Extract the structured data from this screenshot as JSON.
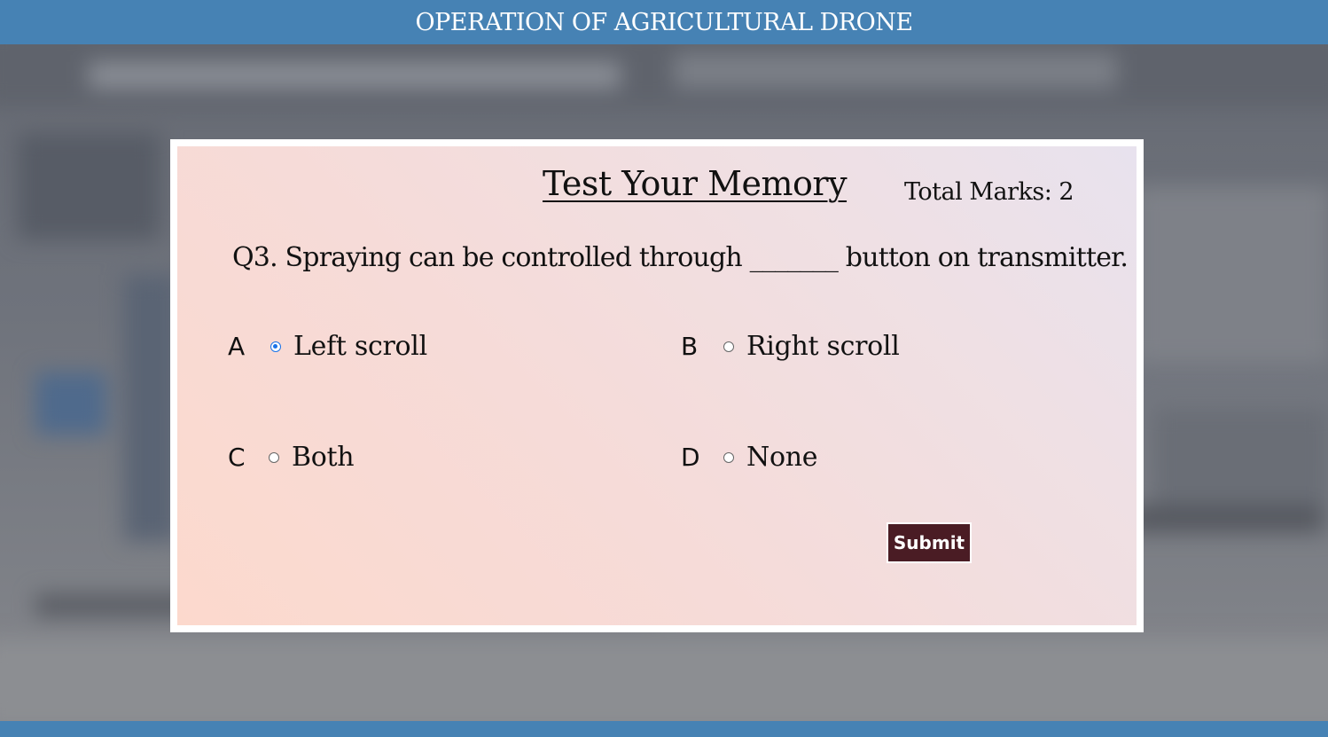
{
  "header": {
    "title": "OPERATION OF AGRICULTURAL DRONE"
  },
  "quiz": {
    "heading": "Test Your Memory",
    "total_marks": "Total Marks: 2",
    "question": "Q3. Spraying can be controlled through _______ button on transmitter.",
    "options": [
      {
        "letter": "A",
        "label": "Left scroll",
        "selected": true
      },
      {
        "letter": "B",
        "label": "Right scroll",
        "selected": false
      },
      {
        "letter": "C",
        "label": "Both",
        "selected": false
      },
      {
        "letter": "D",
        "label": "None",
        "selected": false
      }
    ],
    "submit_label": "Submit"
  },
  "colors": {
    "header_bar": "#4682b4",
    "submit_button": "#4a1c24",
    "radio_selected": "#1a73e8"
  }
}
